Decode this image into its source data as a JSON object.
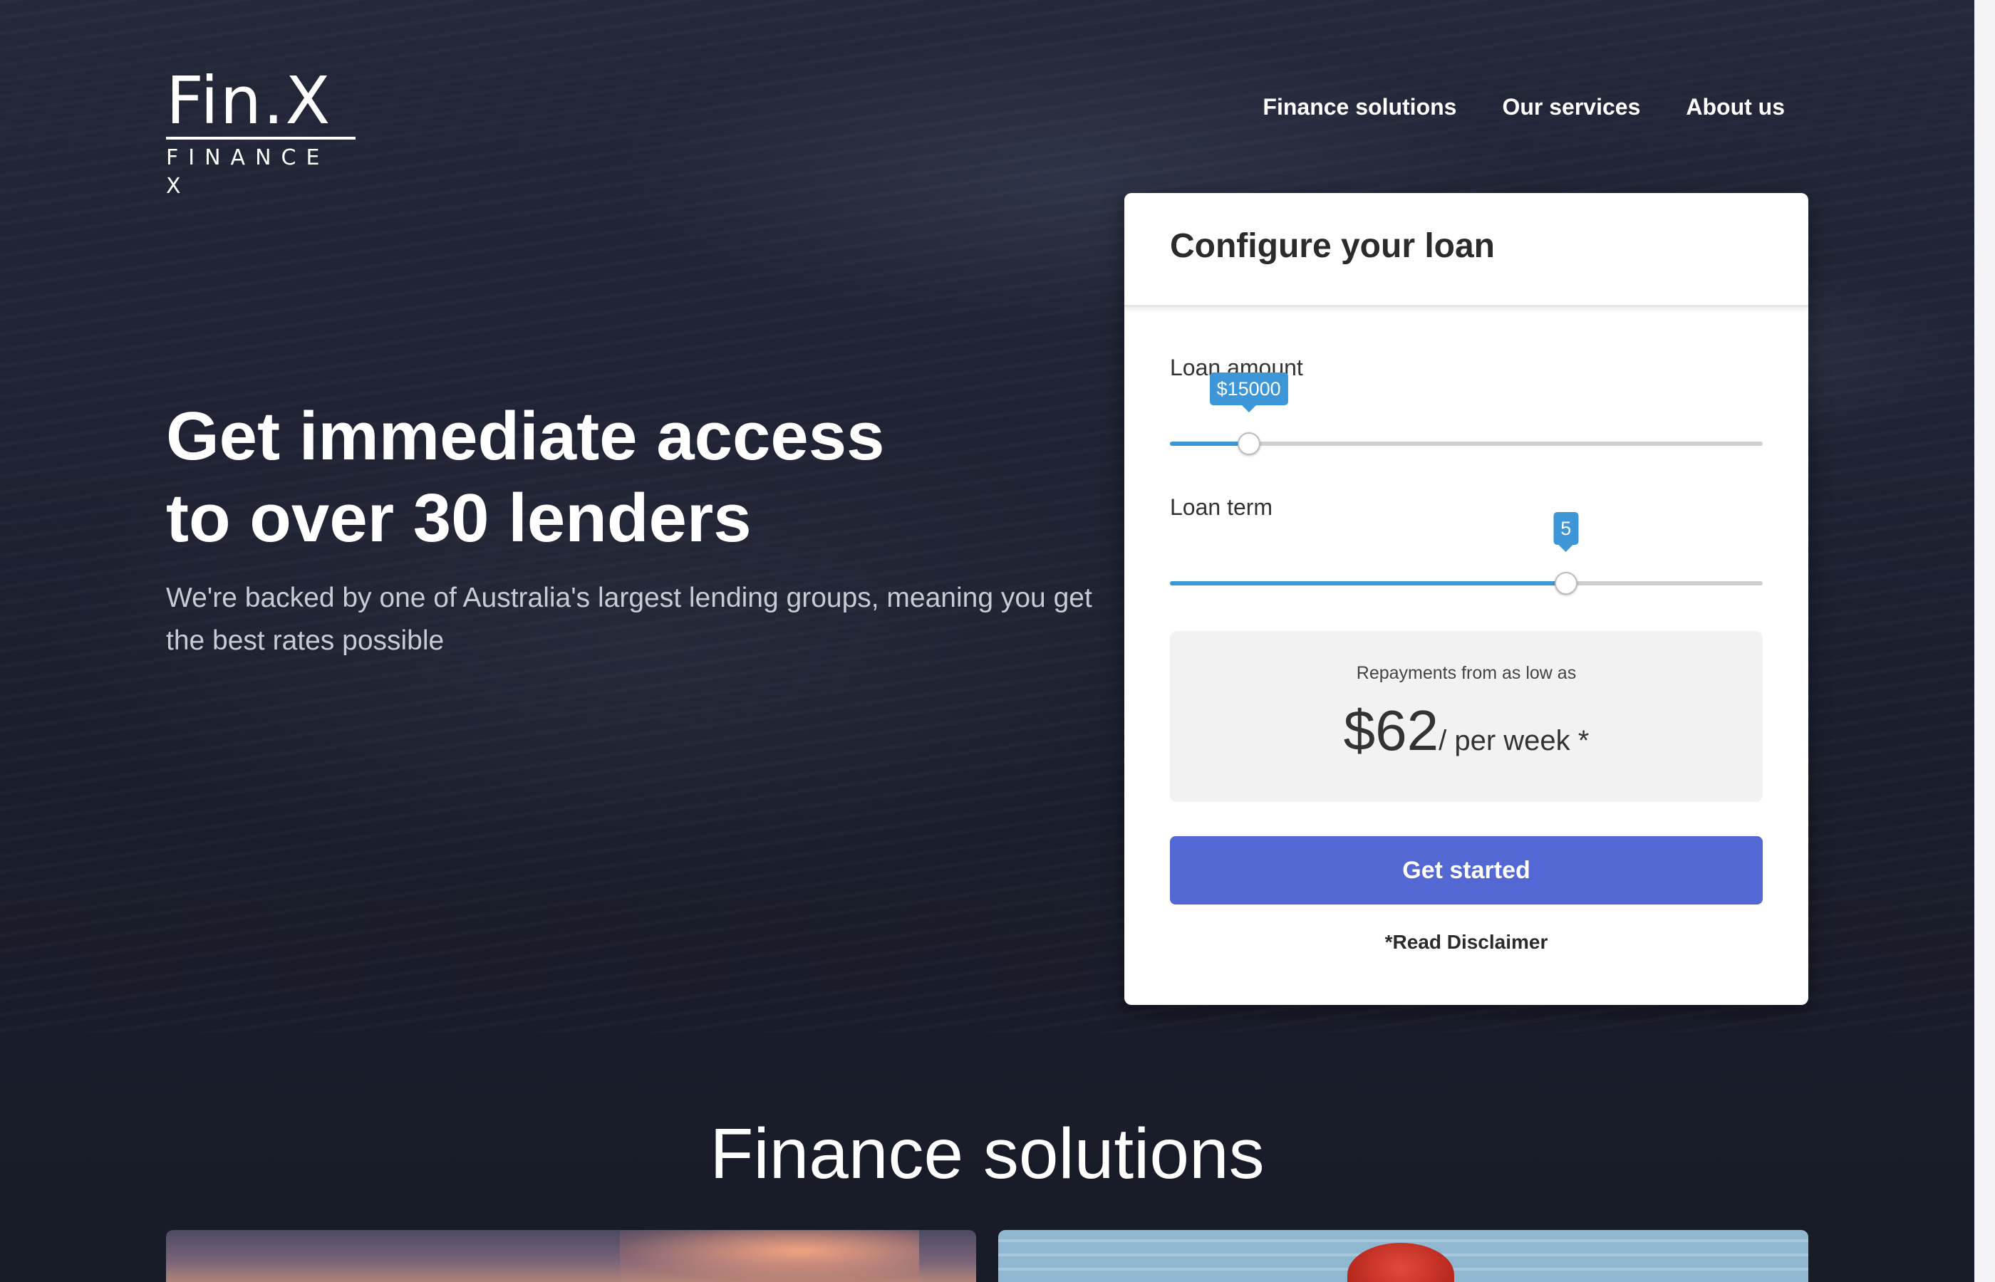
{
  "brand": {
    "logo_main": "Fin.X",
    "logo_sub": "FINANCE X"
  },
  "nav": {
    "items": [
      {
        "label": "Finance solutions"
      },
      {
        "label": "Our services"
      },
      {
        "label": "About us"
      }
    ]
  },
  "hero": {
    "headline_line1": "Get immediate access",
    "headline_line2": "to over 30 lenders",
    "subcopy": "We're backed by one of Australia's largest lending groups, meaning you get the best rates possible"
  },
  "loan_card": {
    "title": "Configure your loan",
    "amount": {
      "label": "Loan amount",
      "value_label": "$15000",
      "fraction": 0.133
    },
    "term": {
      "label": "Loan term",
      "value_label": "5",
      "fraction": 0.668
    },
    "repayment": {
      "caption": "Repayments from as low as",
      "amount": "$62",
      "unit": "/ per week *"
    },
    "cta_label": "Get started",
    "disclaimer_label": "*Read Disclaimer"
  },
  "colors": {
    "background": "#181b28",
    "slider_accent": "#3d96d8",
    "cta": "#5468d4"
  },
  "section": {
    "title": "Finance solutions"
  }
}
